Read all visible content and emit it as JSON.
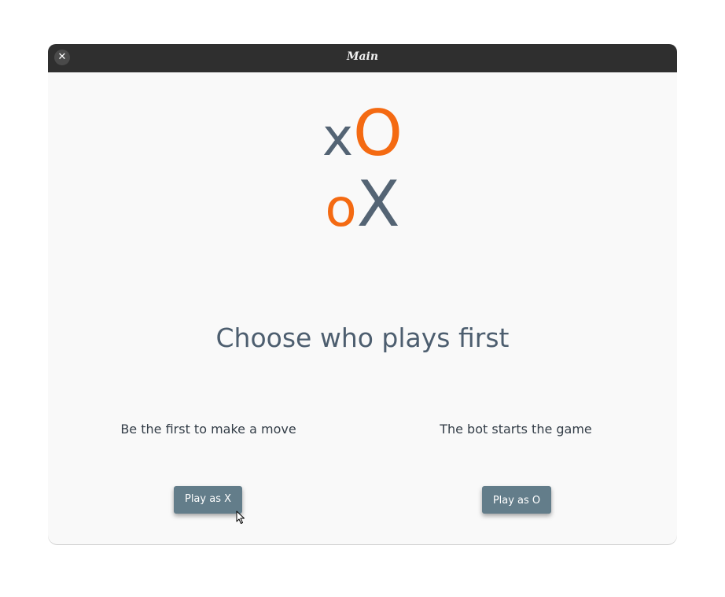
{
  "window": {
    "title": "Main",
    "close_glyph": "✕"
  },
  "logo": {
    "row1": {
      "small": "x",
      "big": "O"
    },
    "row2": {
      "small": "o",
      "big": "X"
    },
    "colors": {
      "slate": "#546474",
      "orange": "#f46a12"
    }
  },
  "main": {
    "heading": "Choose who plays first",
    "options": [
      {
        "caption": "Be the first to make a move",
        "button": "Play as X"
      },
      {
        "caption": "The bot starts the game",
        "button": "Play as O"
      }
    ]
  },
  "colors": {
    "button_bg": "#637d8a",
    "titlebar_bg": "#2f2f2f",
    "content_bg": "#f9f9f9"
  }
}
